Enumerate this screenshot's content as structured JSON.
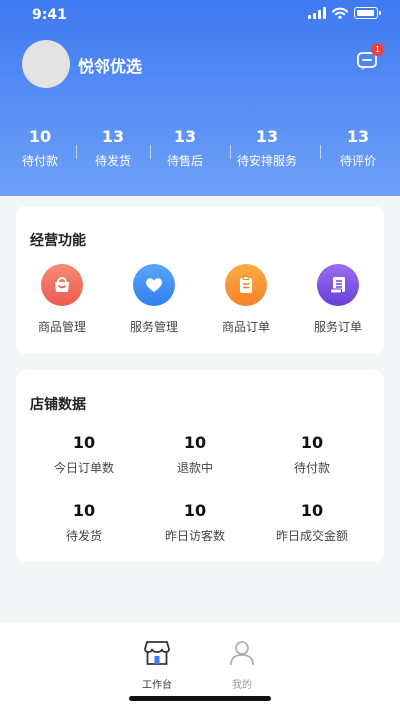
{
  "status_bar": {
    "time": "9:41"
  },
  "header": {
    "shop_name": "悦邻优选",
    "message_badge": "1"
  },
  "order_stats": [
    {
      "value": "10",
      "label": "待付款"
    },
    {
      "value": "13",
      "label": "待发货"
    },
    {
      "value": "13",
      "label": "待售后"
    },
    {
      "value": "13",
      "label": "待安排服务"
    },
    {
      "value": "13",
      "label": "待评价"
    }
  ],
  "business": {
    "title": "经营功能",
    "items": [
      {
        "label": "商品管理",
        "icon": "shop-bag-icon",
        "color": "#f2665a"
      },
      {
        "label": "服务管理",
        "icon": "heart-icon",
        "color": "#3d8ff3"
      },
      {
        "label": "商品订单",
        "icon": "clipboard-icon",
        "color": "#f7942a"
      },
      {
        "label": "服务订单",
        "icon": "receipt-icon",
        "color": "#7b4fe0"
      }
    ]
  },
  "store_data": {
    "title": "店铺数据",
    "metrics": [
      {
        "value": "10",
        "label": "今日订单数"
      },
      {
        "value": "10",
        "label": "退款中"
      },
      {
        "value": "10",
        "label": "待付款"
      },
      {
        "value": "10",
        "label": "待发货"
      },
      {
        "value": "10",
        "label": "昨日访客数"
      },
      {
        "value": "10",
        "label": "昨日成交金额"
      }
    ]
  },
  "tabbar": {
    "tabs": [
      {
        "label": "工作台",
        "icon": "store-icon",
        "active": true
      },
      {
        "label": "我的",
        "icon": "user-icon",
        "active": false
      }
    ]
  },
  "colors": {
    "accent": "#3f79f0",
    "active_tab": "#333333",
    "inactive_tab": "#999999"
  }
}
